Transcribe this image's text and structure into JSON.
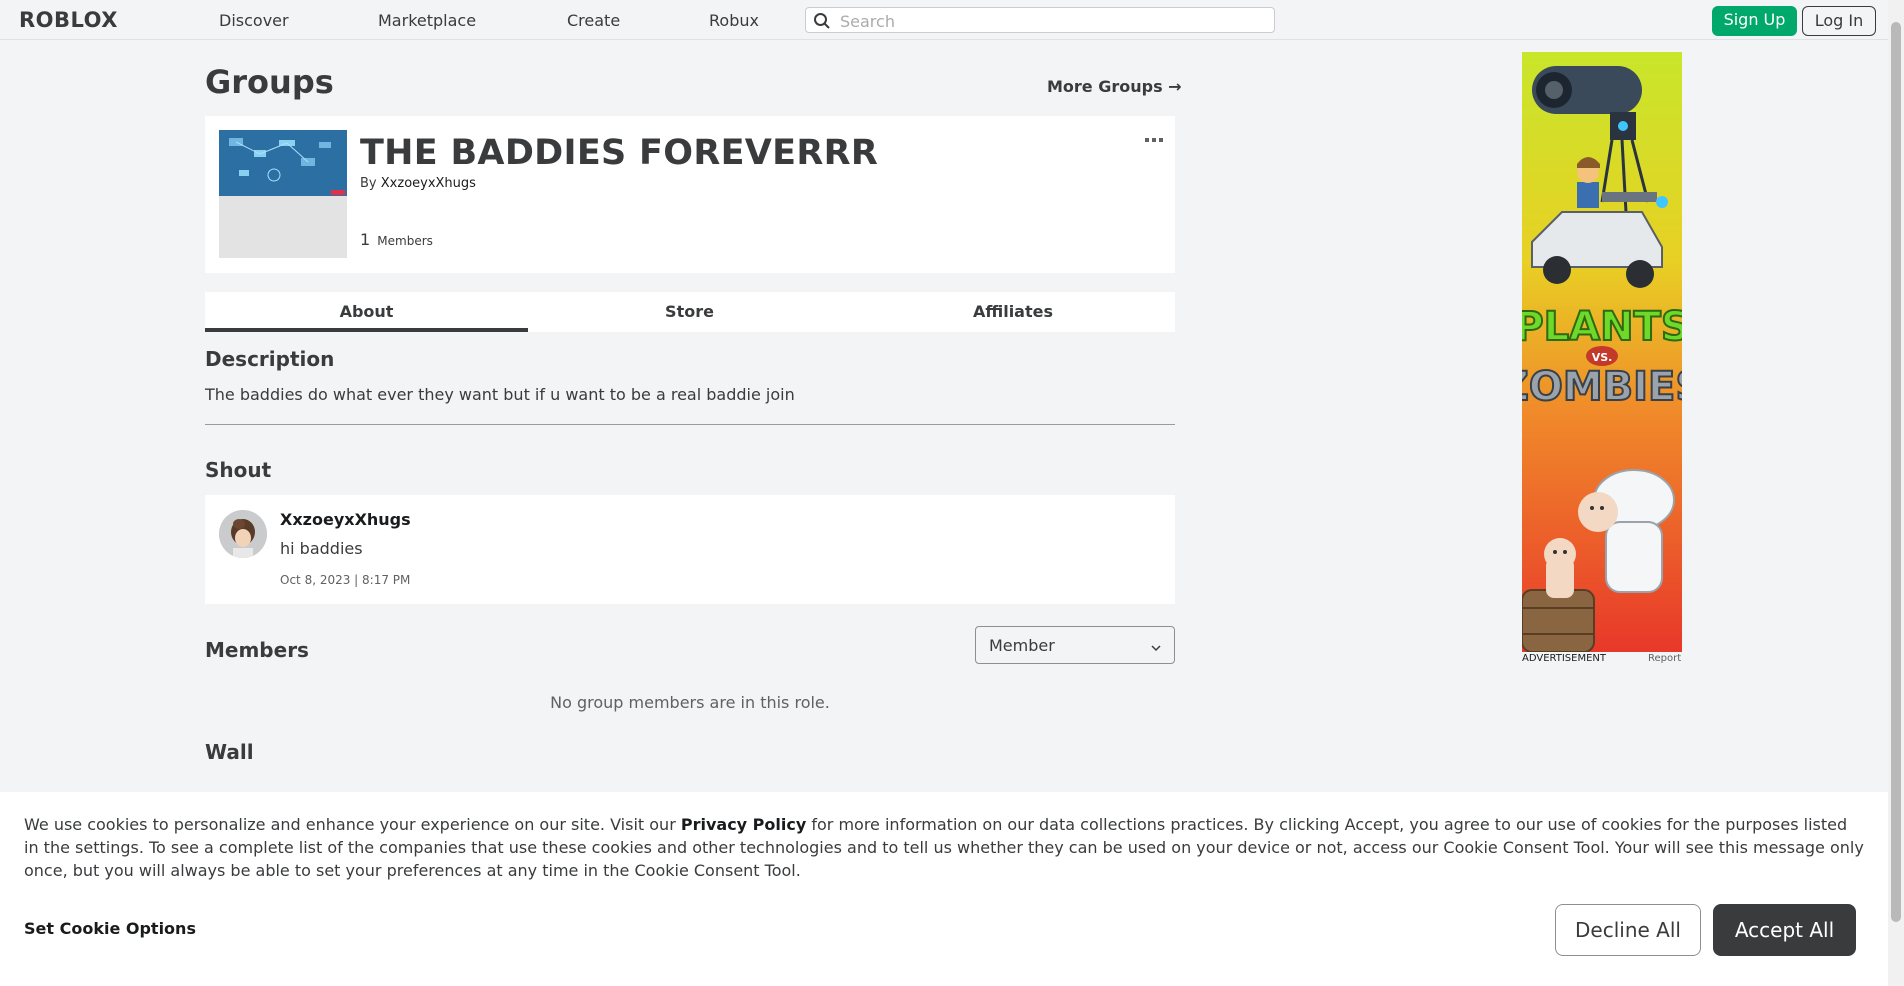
{
  "header": {
    "logo": "ROBLOX",
    "nav": [
      "Discover",
      "Marketplace",
      "Create",
      "Robux"
    ],
    "search_placeholder": "Search",
    "signup_label": "Sign Up",
    "login_label": "Log In"
  },
  "page": {
    "title": "Groups",
    "more_groups": "More Groups →"
  },
  "group": {
    "name": "THE BADDIES FOREVERRR",
    "by_prefix": "By",
    "owner": "XxzoeyxXhugs",
    "member_count": "1",
    "member_label": "Members",
    "more_icon": "ellipsis-icon"
  },
  "tabs": [
    {
      "label": "About",
      "active": true
    },
    {
      "label": "Store",
      "active": false
    },
    {
      "label": "Affiliates",
      "active": false
    }
  ],
  "description": {
    "heading": "Description",
    "text": "The baddies do what ever they want but if u want to be a real baddie join"
  },
  "shout": {
    "heading": "Shout",
    "user": "XxzoeyxXhugs",
    "body": "hi baddies",
    "date": "Oct 8, 2023 | 8:17 PM"
  },
  "members": {
    "heading": "Members",
    "role_selected": "Member",
    "empty_text": "No group members are in this role."
  },
  "wall": {
    "heading": "Wall"
  },
  "ad": {
    "label": "ADVERTISEMENT",
    "report": "Report",
    "title_line1": "PLANTS",
    "title_vs": "VS.",
    "title_line2": "ZOMBIES"
  },
  "cookie": {
    "text_before": "We use cookies to personalize and enhance your experience on our site. Visit our ",
    "policy_link": "Privacy Policy",
    "text_after": " for more information on our data collections practices. By clicking Accept, you agree to our use of cookies for the purposes listed in the settings. To see a complete list of the companies that use these cookies and other technologies and to tell us whether they can be used on your device or not, access our Cookie Consent Tool. Your will see this message only once, but you will always be able to set your preferences at any time in the Cookie Consent Tool.",
    "set_options": "Set Cookie Options",
    "decline": "Decline All",
    "accept": "Accept All"
  },
  "colors": {
    "accent_green": "#00a86b",
    "background": "#f2f4f5",
    "text": "#393b3d",
    "accept_bg": "#393b3d"
  }
}
